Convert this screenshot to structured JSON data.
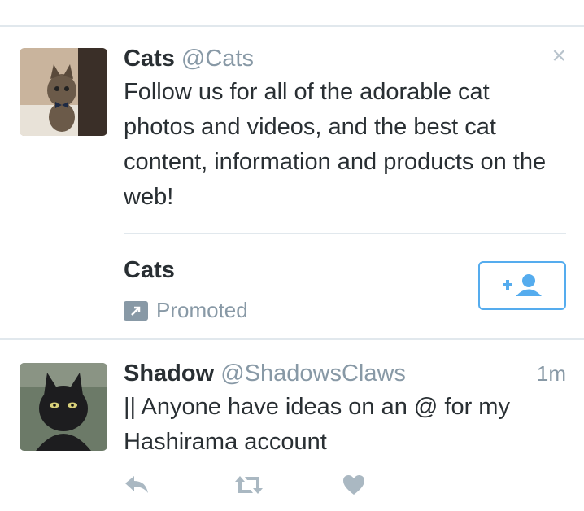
{
  "promoted_tweet": {
    "name": "Cats",
    "handle": "@Cats",
    "text": "Follow us for all of the adorable cat photos and videos, and the best cat content, information and products on the web!",
    "close_symbol": "×",
    "card_title": "Cats",
    "promoted_label": "Promoted",
    "icons": {
      "close": "close-icon",
      "follow": "add-user-icon",
      "promoted": "promoted-arrow-icon"
    }
  },
  "tweet": {
    "name": "Shadow",
    "handle": "@ShadowsClaws",
    "time": "1m",
    "text": "|| Anyone have ideas on an @ for my Hashirama account",
    "actions": [
      "reply-icon",
      "retweet-icon",
      "like-icon"
    ]
  },
  "colors": {
    "accent": "#55acee",
    "muted": "#8899a6",
    "text": "#292f33",
    "divider": "#e1e8ed"
  }
}
